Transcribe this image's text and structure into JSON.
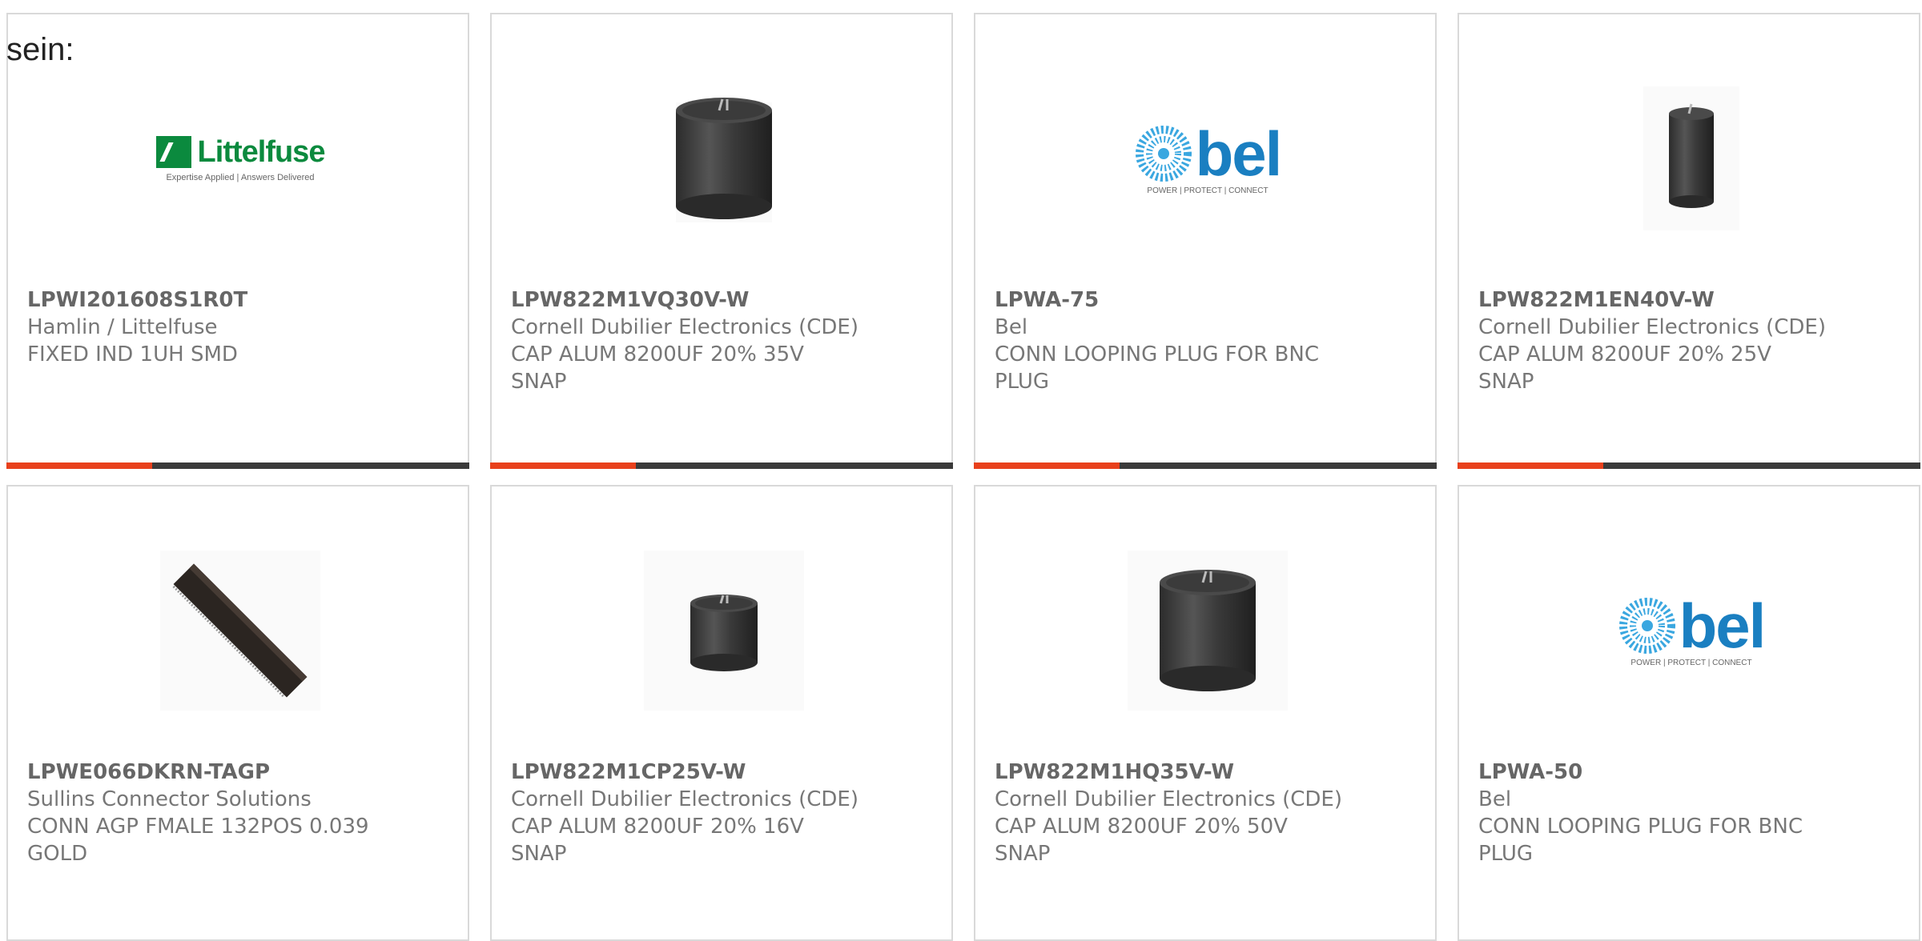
{
  "heading": "sein:",
  "products": [
    {
      "part_number": "LPWI201608S1R0T",
      "manufacturer": "Hamlin / Littelfuse",
      "description": "FIXED IND 1UH SMD",
      "image": "littelfuse-logo",
      "logo_text": "Littelfuse",
      "logo_tagline": "Expertise Applied | Answers Delivered"
    },
    {
      "part_number": "LPW822M1VQ30V-W",
      "manufacturer": "Cornell Dubilier Electronics (CDE)",
      "description": "CAP ALUM 8200UF 20% 35V SNAP",
      "image": "capacitor-large"
    },
    {
      "part_number": "LPWA-75",
      "manufacturer": "Bel",
      "description": "CONN LOOPING PLUG FOR BNC PLUG",
      "image": "bel-logo",
      "logo_text": "bel",
      "logo_tagline": "POWER | PROTECT | CONNECT"
    },
    {
      "part_number": "LPW822M1EN40V-W",
      "manufacturer": "Cornell Dubilier Electronics (CDE)",
      "description": "CAP ALUM 8200UF 20% 25V SNAP",
      "image": "capacitor-tall"
    },
    {
      "part_number": "LPWE066DKRN-TAGP",
      "manufacturer": "Sullins Connector Solutions",
      "description": "CONN AGP FMALE 132POS 0.039 GOLD",
      "image": "edge-connector"
    },
    {
      "part_number": "LPW822M1CP25V-W",
      "manufacturer": "Cornell Dubilier Electronics (CDE)",
      "description": "CAP ALUM 8200UF 20% 16V SNAP",
      "image": "capacitor-small"
    },
    {
      "part_number": "LPW822M1HQ35V-W",
      "manufacturer": "Cornell Dubilier Electronics (CDE)",
      "description": "CAP ALUM 8200UF 20% 50V SNAP",
      "image": "capacitor-large"
    },
    {
      "part_number": "LPWA-50",
      "manufacturer": "Bel",
      "description": "CONN LOOPING PLUG FOR BNC PLUG",
      "image": "bel-logo",
      "logo_text": "bel",
      "logo_tagline": "POWER | PROTECT | CONNECT"
    }
  ],
  "colors": {
    "accent": "#e8401c",
    "bar": "#3a3a3a",
    "littelfuse_green": "#0b8a3e",
    "bel_blue": "#1a7fc1"
  }
}
